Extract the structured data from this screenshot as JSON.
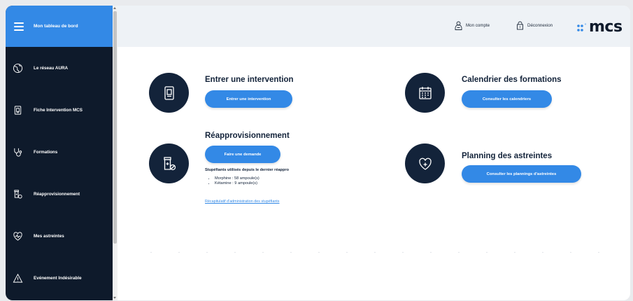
{
  "sidebar": {
    "title": "Mon tableau de bord",
    "items": [
      {
        "label": "Le réseau AURA",
        "icon": "globe-icon"
      },
      {
        "label": "Fiche Intervention MCS",
        "icon": "clipboard-icon"
      },
      {
        "label": "Formations",
        "icon": "stethoscope-icon"
      },
      {
        "label": "Réapprovisionnement",
        "icon": "medicine-bottle-icon"
      },
      {
        "label": "Mes astreintes",
        "icon": "heart-pulse-icon"
      },
      {
        "label": "Evénement Indésirable",
        "icon": "warning-icon"
      }
    ]
  },
  "header": {
    "account": "Mon compte",
    "logout": "Déconnexion",
    "logo": "mcs"
  },
  "main": {
    "intervention": {
      "title": "Entrer une intervention",
      "button": "Entrer une intervention"
    },
    "reappro": {
      "title": "Réapprovisionnement",
      "button": "Faire une demande",
      "info_heading": "Stupéfiants utilisés depuis le dernier réappro",
      "items": [
        "Morphine : 58 ampoule(s)",
        "Kétamine : 9 ampoule(s)"
      ],
      "link": "Récapitulatif d'administration des stupéfiants"
    },
    "calendrier": {
      "title": "Calendrier des formations",
      "button": "Consulter les calendriers"
    },
    "planning": {
      "title": "Planning des astreintes",
      "button": "Consulter les plannings d'astreintes"
    }
  },
  "colors": {
    "accent": "#3389e6",
    "sidebar": "#0e1a2b",
    "header": "#eef2f6"
  }
}
